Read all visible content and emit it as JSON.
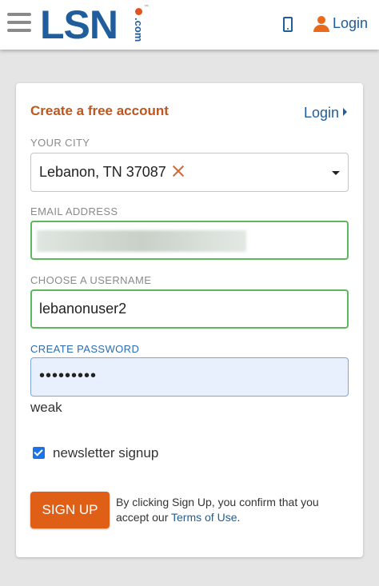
{
  "header": {
    "logo_text": "LSN",
    "logo_suffix": ".com",
    "logo_tm": "™",
    "login_label": "Login",
    "icons": [
      "menu-icon",
      "phone-icon",
      "user-icon"
    ]
  },
  "form": {
    "title": "Create a free account",
    "login_link": "Login",
    "city": {
      "label": "YOUR CITY",
      "value": "Lebanon, TN 37087"
    },
    "email": {
      "label": "EMAIL ADDRESS",
      "value": ""
    },
    "username": {
      "label": "CHOOSE A USERNAME",
      "value": "lebanonuser2"
    },
    "password": {
      "label": "CREATE PASSWORD",
      "value": "•••••••••",
      "strength": "weak"
    },
    "newsletter": {
      "label": "newsletter signup",
      "checked": true
    },
    "signup_button": "SIGN UP",
    "terms_prefix": "By clicking Sign Up, you confirm that you accept our ",
    "terms_link": "Terms of Use",
    "terms_suffix": "."
  },
  "colors": {
    "brand_blue": "#1f5d9c",
    "accent_orange": "#e05f17",
    "valid_green": "#5cb85c"
  }
}
